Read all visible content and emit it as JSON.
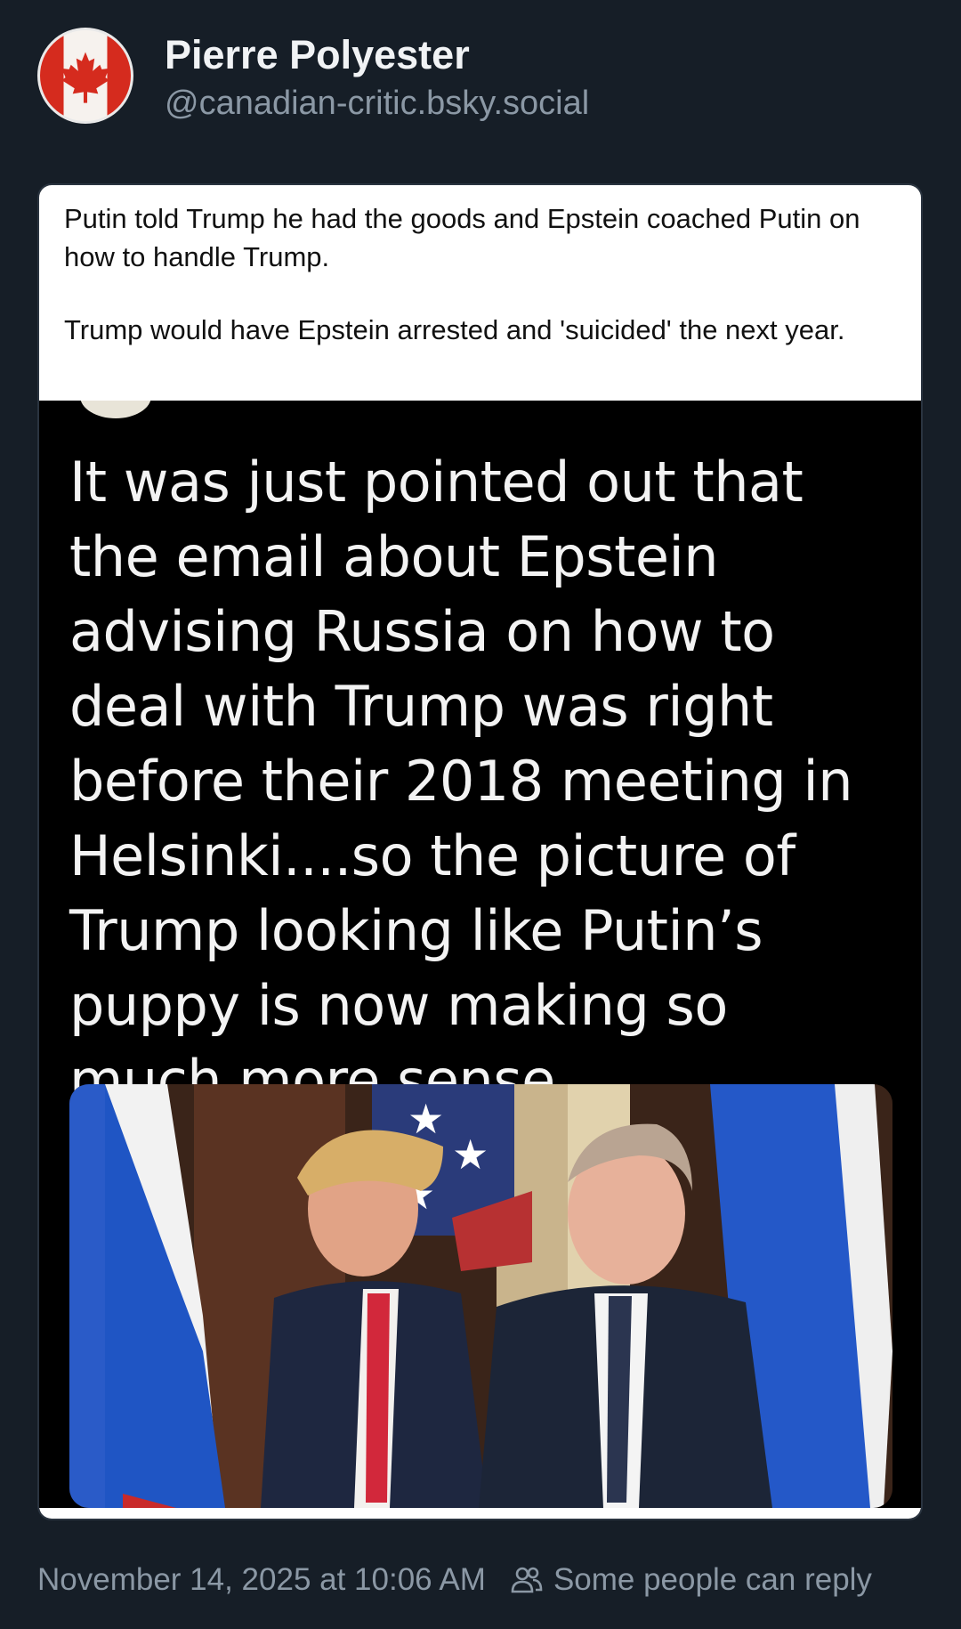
{
  "author": {
    "display_name": "Pierre Polyester",
    "handle": "@canadian-critic.bsky.social",
    "avatar_icon": "canada-flag-icon"
  },
  "media": {
    "caption_paragraphs": [
      "Putin told Trump he had the goods and Epstein coached Putin on how to handle Trump.",
      "Trump would have Epstein arrested and 'suicided' the next year."
    ],
    "tweet_text": "It was just pointed out that the email about Epstein advising Russia on how to deal with Trump was right before their 2018 meeting in Helsinki....so the picture of Trump looking like Putin’s puppy is now making so much more sense",
    "photo_icon": "press-photo-image"
  },
  "footer": {
    "timestamp": "November 14, 2025 at 10:06 AM",
    "reply_setting": "Some people can reply",
    "reply_icon": "people-icon"
  },
  "colors": {
    "background": "#161e27",
    "muted_text": "#8b98a5"
  }
}
